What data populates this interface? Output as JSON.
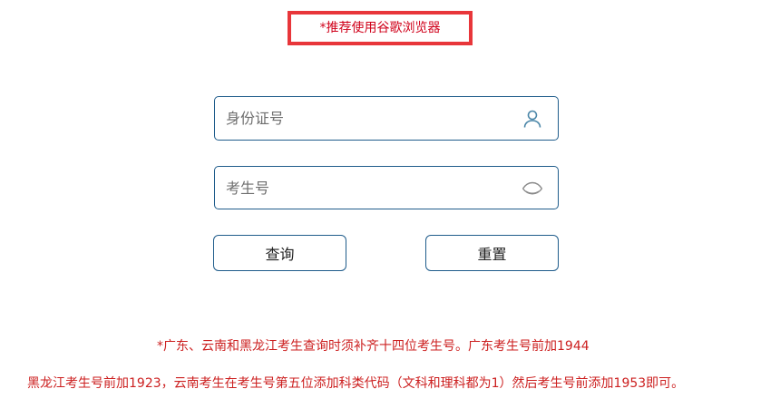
{
  "header": {
    "browser_recommendation": "*推荐使用谷歌浏览器"
  },
  "form": {
    "id_field": {
      "placeholder": "身份证号",
      "value": "",
      "icon": "user-icon"
    },
    "exam_field": {
      "placeholder": "考生号",
      "value": "",
      "icon": "eye-icon"
    },
    "query_label": "查询",
    "reset_label": "重置"
  },
  "notice": {
    "line1": "*广东、云南和黑龙江考生查询时须补齐十四位考生号。广东考生号前加1944",
    "line2": "黑龙江考生号前加1923，云南考生在考生号第五位添加科类代码（文科和理科都为1）然后考生号前添加1953即可。"
  },
  "colors": {
    "accent_border": "#1f5c8b",
    "warning_text": "#cc1f1f",
    "highlight_box": "#e8363a",
    "icon": "#4a86a8"
  }
}
